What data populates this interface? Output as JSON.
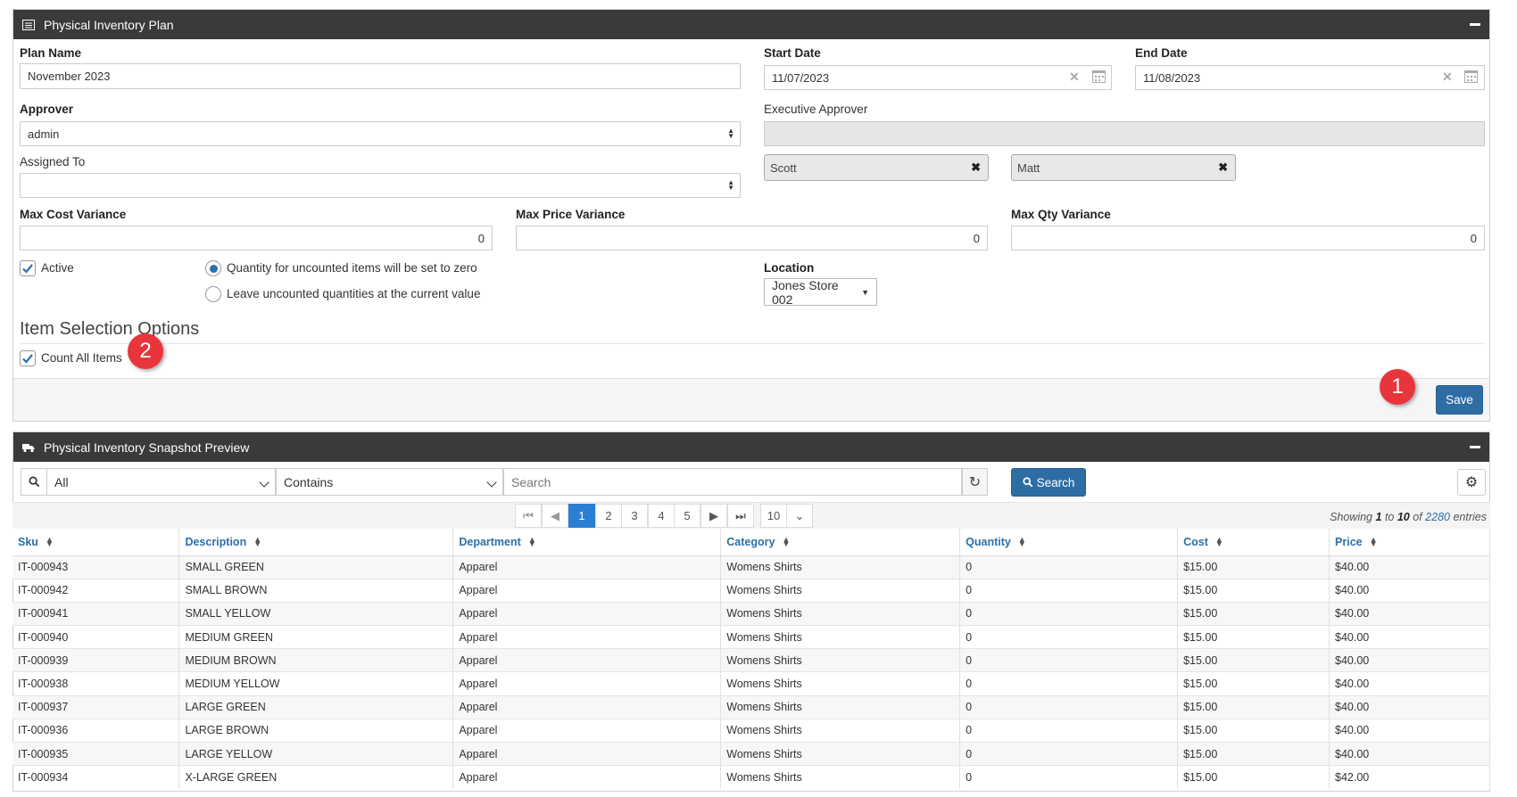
{
  "plan_panel": {
    "title": "Physical Inventory Plan",
    "plan_name_label": "Plan Name",
    "plan_name_value": "November 2023",
    "start_date_label": "Start Date",
    "start_date_value": "11/07/2023",
    "end_date_label": "End Date",
    "end_date_value": "11/08/2023",
    "approver_label": "Approver",
    "approver_value": "admin",
    "executive_approver_label": "Executive Approver",
    "assigned_to_label": "Assigned To",
    "assigned_tags": [
      "Scott",
      "Matt"
    ],
    "max_cost_variance_label": "Max Cost Variance",
    "max_cost_variance_value": "0",
    "max_price_variance_label": "Max Price Variance",
    "max_price_variance_value": "0",
    "max_qty_variance_label": "Max Qty Variance",
    "max_qty_variance_value": "0",
    "active_label": "Active",
    "radio_zero_label": "Quantity for uncounted items will be set to zero",
    "radio_current_label": "Leave uncounted quantities at the current value",
    "location_label": "Location",
    "location_value": "Jones Store 002",
    "item_selection_heading": "Item Selection Options",
    "count_all_label": "Count All Items",
    "save_label": "Save"
  },
  "callouts": {
    "one": "1",
    "two": "2"
  },
  "snapshot_panel": {
    "title": "Physical Inventory Snapshot Preview",
    "filter_field": "All",
    "filter_operator": "Contains",
    "search_placeholder": "Search",
    "search_button": "Search",
    "pages": [
      "1",
      "2",
      "3",
      "4",
      "5"
    ],
    "page_size": "10",
    "showing": {
      "prefix": "Showing",
      "from": "1",
      "to_word": "to",
      "to": "10",
      "of_word": "of",
      "total": "2280",
      "suffix": "entries"
    },
    "columns": [
      "Sku",
      "Description",
      "Department",
      "Category",
      "Quantity",
      "Cost",
      "Price"
    ],
    "rows": [
      [
        "IT-000943",
        "SMALL GREEN",
        "Apparel",
        "Womens Shirts",
        "0",
        "$15.00",
        "$40.00"
      ],
      [
        "IT-000942",
        "SMALL BROWN",
        "Apparel",
        "Womens Shirts",
        "0",
        "$15.00",
        "$40.00"
      ],
      [
        "IT-000941",
        "SMALL YELLOW",
        "Apparel",
        "Womens Shirts",
        "0",
        "$15.00",
        "$40.00"
      ],
      [
        "IT-000940",
        "MEDIUM GREEN",
        "Apparel",
        "Womens Shirts",
        "0",
        "$15.00",
        "$40.00"
      ],
      [
        "IT-000939",
        "MEDIUM BROWN",
        "Apparel",
        "Womens Shirts",
        "0",
        "$15.00",
        "$40.00"
      ],
      [
        "IT-000938",
        "MEDIUM YELLOW",
        "Apparel",
        "Womens Shirts",
        "0",
        "$15.00",
        "$40.00"
      ],
      [
        "IT-000937",
        "LARGE GREEN",
        "Apparel",
        "Womens Shirts",
        "0",
        "$15.00",
        "$40.00"
      ],
      [
        "IT-000936",
        "LARGE BROWN",
        "Apparel",
        "Womens Shirts",
        "0",
        "$15.00",
        "$40.00"
      ],
      [
        "IT-000935",
        "LARGE YELLOW",
        "Apparel",
        "Womens Shirts",
        "0",
        "$15.00",
        "$40.00"
      ],
      [
        "IT-000934",
        "X-LARGE GREEN",
        "Apparel",
        "Womens Shirts",
        "0",
        "$15.00",
        "$42.00"
      ]
    ]
  },
  "colors": {
    "header_bg": "#3a3a3a",
    "accent_blue": "#2e6da4",
    "callout_red": "#e8353b"
  }
}
